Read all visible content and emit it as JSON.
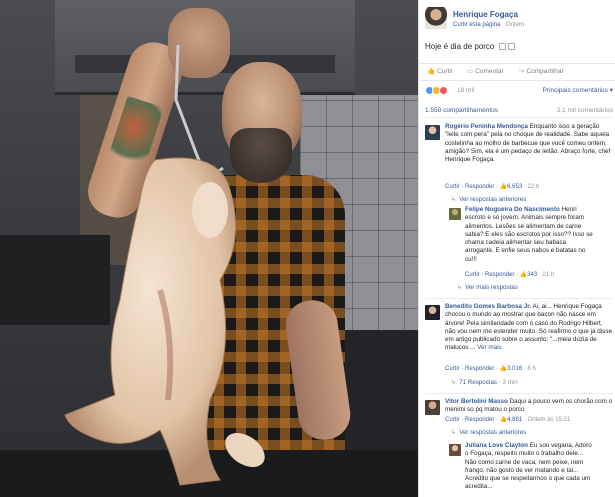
{
  "colors": {
    "link": "#365899",
    "muted": "#90949c",
    "like_blue": "#5890ff",
    "love_red": "#f25268",
    "haha_yellow": "#f7b928"
  },
  "photo": {
    "icon": "chef-holding-pig-photo"
  },
  "page": {
    "name": "Henrique Fogaça",
    "curtir_pagina": "Curtir esta página",
    "time": "Ontem"
  },
  "post": {
    "text": "Hoje é dia de porco"
  },
  "actions": {
    "like": "Curtir",
    "comment": "Comentar",
    "share": "Compartilhar"
  },
  "reactions": {
    "count": "18 mil",
    "sort": "Principais comentários ▾"
  },
  "shares": {
    "left": "1.550 compartilhamentos",
    "right": "3,1 mil comentários"
  },
  "comments": [
    {
      "author": "Rogério Peninha Mendonça",
      "text": "Enquanto isso a geração \"leite com pera\" pela no choque de realidade. Sabe aquela costelinha ao molho de barbecue que você comeu ontem, amigão? Sim, ela é um pedaço de leitão. Abraço forte, chef Henrique Fogaça.",
      "meta_actions": "Curtir · Responder ·",
      "likes": "6.653",
      "time": "22 h",
      "more": "Ver respostas anteriores"
    },
    {
      "author": "Felipe Nogueira Do Nascimento",
      "text": "Henri escroto e só jovem. Animais sempre foram alimentos. Lesões se alimentam de carne sabia? E eles são escrotos por isso?? Isso se chama cadeia alimentar seu babaca arrogante. E enfie seus nabos e batatas no cu!!!",
      "meta_actions": "Curtir · Responder ·",
      "likes": "343",
      "time": "21 h",
      "more": "Ver mais respostas"
    },
    {
      "author": "Benedito Gomes Barbosa Jr.",
      "text": "Ai, ai... Henrique Fogaça chocou o mundo ao mostrar que bacon não nasce em árvore! Pela similaridade com o caso do Rodrigo Hilbert, não vou nem me estender muito. Só reafirmo o que já disse em artigo publicado sobre o assunto: \"...meia dúzia de malucos ...",
      "see_more": "Ver mais",
      "meta_actions": "Curtir · Responder ·",
      "likes": "3.016",
      "time": "6 h",
      "more": "71 Respostas",
      "more_time": "3 min"
    },
    {
      "author": "Vitor Bertolini Masso",
      "text": "Daqui a pouco vem os chorão com o menimi so pq matou o porco",
      "meta_actions": "Curtir · Responder ·",
      "likes": "4.881",
      "time": "Ontem às 15:21",
      "more": "Ver respostas anteriores"
    },
    {
      "author": "Juliana Love Clayton",
      "text": "Eu sou vegana, Adoro o Fogaça, respeito muito o trabalho dele... Não como carne de vaca, nem peixe, nem frango, não gosto de ver matando e tal... Acredito que se respeitarmos o que cada um acredita..."
    }
  ]
}
